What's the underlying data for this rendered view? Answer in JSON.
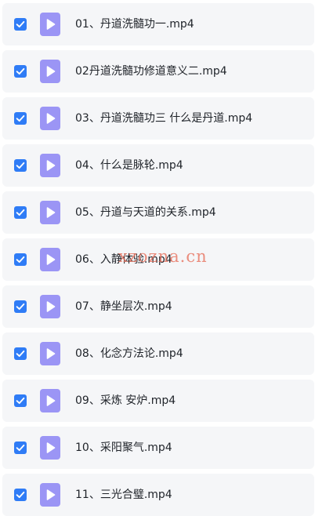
{
  "colors": {
    "checkbox": "#2f7cf6",
    "file_icon": "#9b95f5",
    "row_background": "#f5f6f8",
    "watermark": "#e76e5a"
  },
  "icons": {
    "checkbox": "checkmark-icon",
    "file": "video-file-play-icon"
  },
  "files": [
    {
      "name": "01、丹道洗髓功一.mp4",
      "checked": true
    },
    {
      "name": "02丹道洗髓功修道意义二.mp4",
      "checked": true
    },
    {
      "name": "03、丹道洗髓功三 什么是丹道.mp4",
      "checked": true
    },
    {
      "name": "04、什么是脉轮.mp4",
      "checked": true
    },
    {
      "name": "05、丹道与天道的关系.mp4",
      "checked": true
    },
    {
      "name": "06、入静体验.mp4",
      "checked": true
    },
    {
      "name": "07、静坐层次.mp4",
      "checked": true
    },
    {
      "name": "08、化念方法论.mp4",
      "checked": true
    },
    {
      "name": "09、采炼 安炉.mp4",
      "checked": true
    },
    {
      "name": "10、采阳聚气.mp4",
      "checked": true
    },
    {
      "name": "11、三光合璧.mp4",
      "checked": true
    }
  ],
  "watermark": {
    "text": "xzozna.cn"
  }
}
